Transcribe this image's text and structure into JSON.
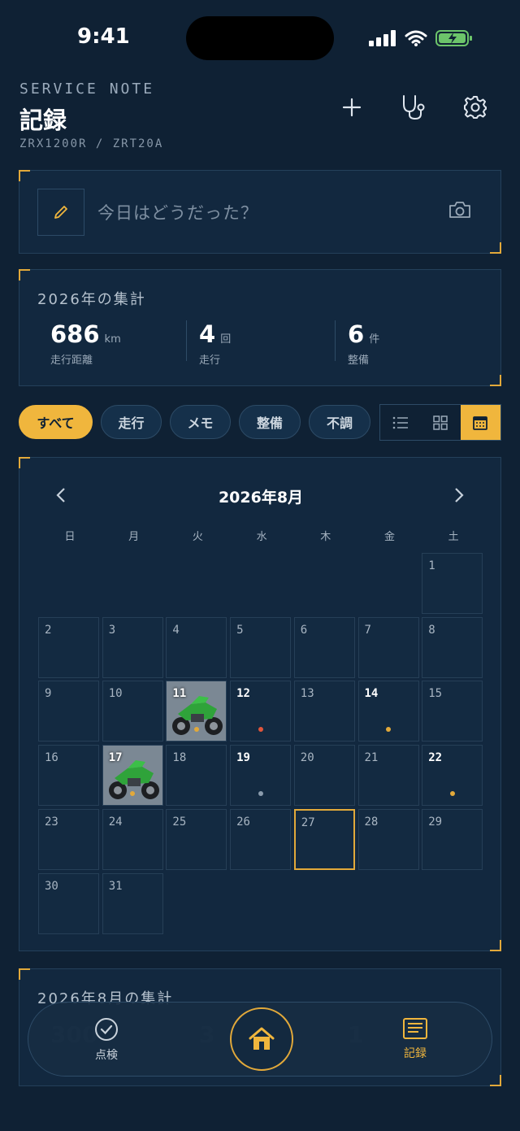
{
  "status_bar": {
    "time": "9:41"
  },
  "header": {
    "brand": "SERVICE NOTE",
    "title": "記録",
    "model": "ZRX1200R / ZRT20A"
  },
  "compose": {
    "placeholder": "今日はどうだった？"
  },
  "yearly_summary": {
    "title": "2026年の集計",
    "stats": [
      {
        "value": "686",
        "unit": "km",
        "label": "走行距離"
      },
      {
        "value": "4",
        "unit": "回",
        "label": "走行"
      },
      {
        "value": "6",
        "unit": "件",
        "label": "整備"
      }
    ]
  },
  "filters": {
    "chips": [
      "すべて",
      "走行",
      "メモ",
      "整備",
      "不調"
    ],
    "active": "すべて"
  },
  "view_toggle": {
    "options": [
      "list-icon",
      "grid-icon",
      "calendar-icon"
    ],
    "active": "calendar-icon"
  },
  "calendar": {
    "title": "2026年8月",
    "weekdays": [
      "日",
      "月",
      "火",
      "水",
      "木",
      "金",
      "土"
    ],
    "first_weekday": 6,
    "days_in_month": 31,
    "today": 27,
    "bold_days": [
      11,
      12,
      14,
      17,
      19,
      22
    ],
    "photo_days": [
      11,
      17
    ],
    "event_dots": {
      "11": "#e2a93a",
      "12": "#e0553b",
      "14": "#e2a93a",
      "17": "#e2a93a",
      "19": "#8a9bac",
      "22": "#e2a93a"
    }
  },
  "monthly_summary": {
    "title": "2026年8月の集計",
    "stats": [
      {
        "value": "300"
      },
      {
        "value": "3"
      },
      {
        "value": "1"
      }
    ]
  },
  "tab_bar": {
    "tabs": [
      {
        "label": "点検",
        "icon": "check-circle-icon"
      },
      {
        "label": "",
        "icon": "home-icon"
      },
      {
        "label": "記録",
        "icon": "notebook-icon"
      }
    ],
    "active": "記録"
  },
  "colors": {
    "accent": "#f0b63d",
    "background": "#0f2134",
    "panel": "#12283f"
  }
}
